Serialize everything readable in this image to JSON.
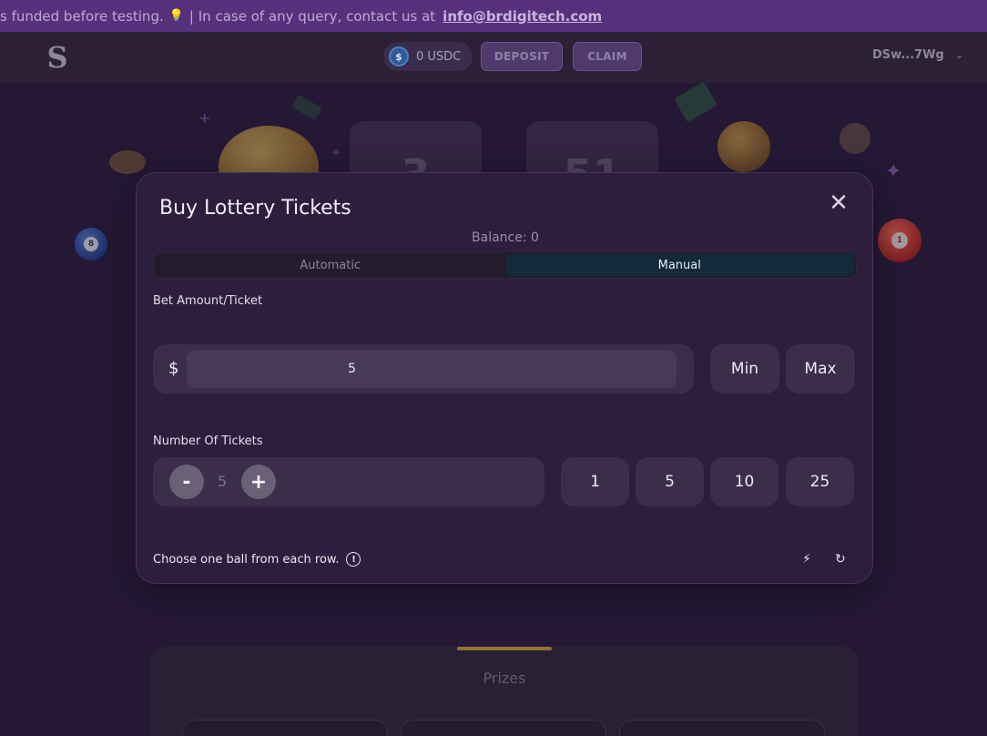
{
  "banner": {
    "text": "s funded before testing.",
    "bulb_icon": "lightbulb-icon",
    "contact_text": "| In case of any query, contact us at",
    "email": "info@brdigitech.com"
  },
  "header": {
    "logo": "S",
    "balance": "0 USDC",
    "deposit_label": "DEPOSIT",
    "claim_label": "CLAIM",
    "wallet": "DSw...7Wg"
  },
  "background": {
    "card_1": "3",
    "card_2": "51",
    "ball_blue": "8",
    "ball_red": "1"
  },
  "modal": {
    "title": "Buy Lottery Tickets",
    "balance": "Balance: 0",
    "tabs": [
      "Automatic",
      "Manual"
    ],
    "active_tab": "Manual",
    "bet_label": "Bet Amount/Ticket",
    "currency": "$",
    "bet_value": "5",
    "min_label": "Min",
    "max_label": "Max",
    "tickets_label": "Number Of Tickets",
    "minus_label": "-",
    "plus_label": "+",
    "tickets_value": "5",
    "presets": [
      "1",
      "5",
      "10",
      "25"
    ],
    "hint": "Choose one ball from each row.",
    "info_icon": "!"
  },
  "prizes": {
    "title": "Prizes"
  },
  "colors": {
    "banner": "#58317c",
    "modal_bg": "#2c1e3c",
    "active_tab": "#132a3a",
    "accent_gold": "#d6a53a"
  }
}
